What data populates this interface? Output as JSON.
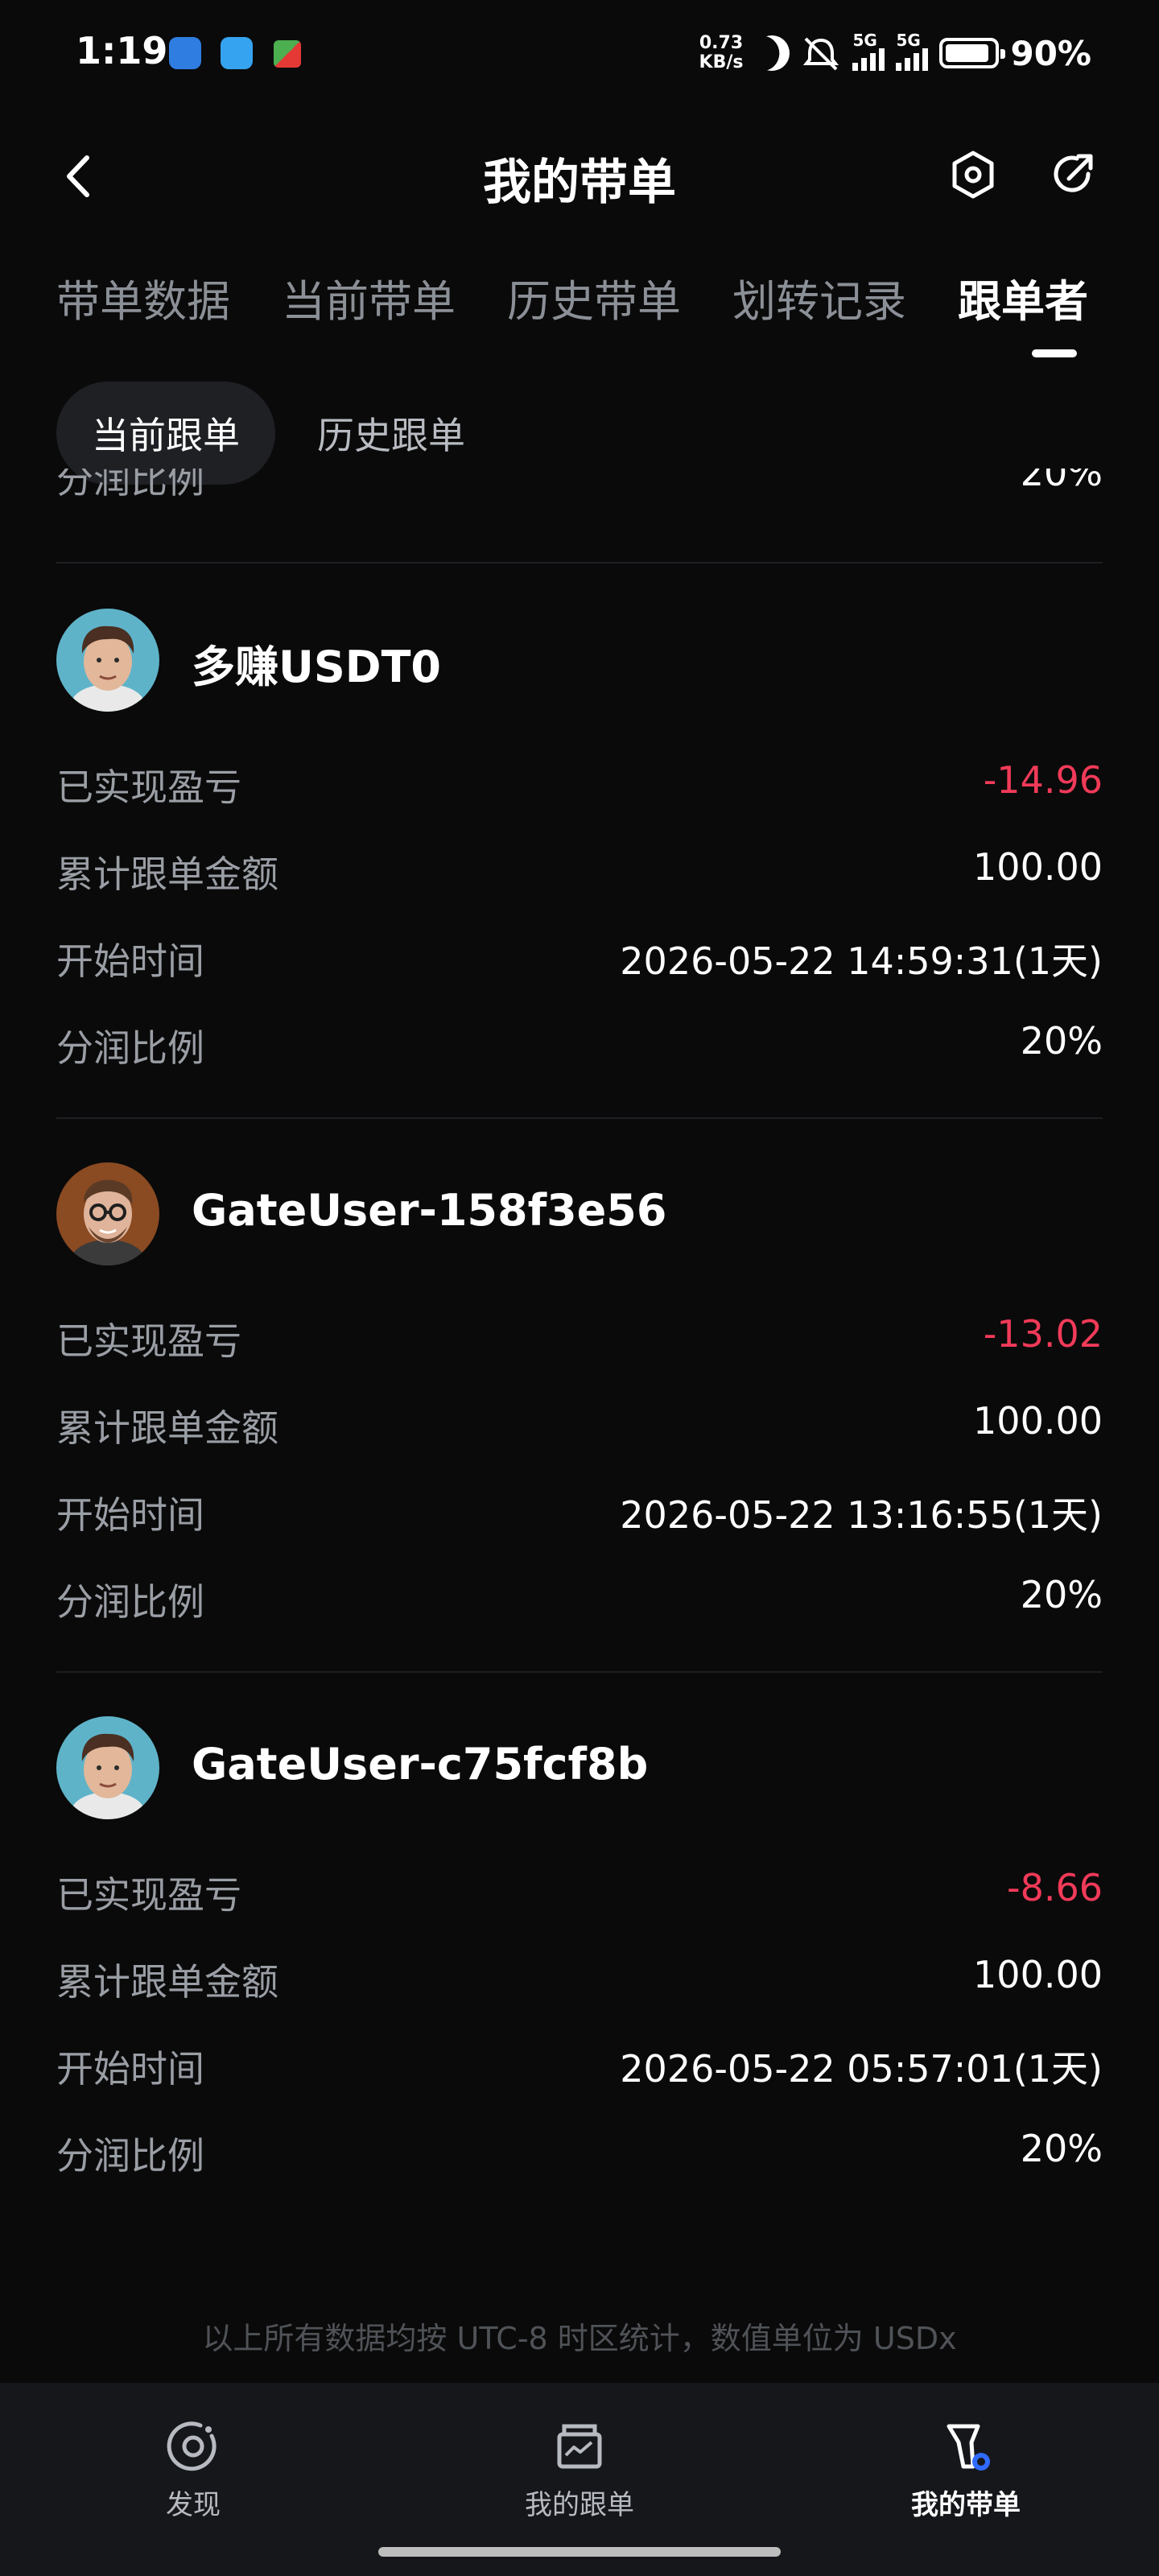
{
  "status_bar": {
    "time": "1:19",
    "net_speed_value": "0.73",
    "net_speed_unit": "KB/s",
    "signal1_label": "5G",
    "signal2_label": "5G",
    "battery": "90%",
    "battery_level": 0.9
  },
  "header": {
    "title": "我的带单",
    "icons": [
      "back-icon",
      "settings-hex-icon",
      "share-icon"
    ]
  },
  "tabs": [
    {
      "label": "带单数据",
      "active": false
    },
    {
      "label": "当前带单",
      "active": false
    },
    {
      "label": "历史带单",
      "active": false
    },
    {
      "label": "划转记录",
      "active": false
    },
    {
      "label": "跟单者",
      "active": true
    }
  ],
  "subtabs": [
    {
      "label": "当前跟单",
      "active": true
    },
    {
      "label": "历史跟单",
      "active": false
    }
  ],
  "partial_row": {
    "label": "分润比例",
    "value": "20%"
  },
  "followers": [
    {
      "name": "多赚USDT0",
      "rows": [
        {
          "label": "已实现盈亏",
          "value": "-14.96"
        },
        {
          "label": "累计跟单金额",
          "value": "100.00"
        },
        {
          "label": "开始时间",
          "value": "2026-05-22 14:59:31(1天)"
        },
        {
          "label": "分润比例",
          "value": "20%"
        }
      ]
    },
    {
      "name": "GateUser-158f3e56",
      "rows": [
        {
          "label": "已实现盈亏",
          "value": "-13.02"
        },
        {
          "label": "累计跟单金额",
          "value": "100.00"
        },
        {
          "label": "开始时间",
          "value": "2026-05-22 13:16:55(1天)"
        },
        {
          "label": "分润比例",
          "value": "20%"
        }
      ]
    },
    {
      "name": "GateUser-c75fcf8b",
      "rows": [
        {
          "label": "已实现盈亏",
          "value": "-8.66"
        },
        {
          "label": "累计跟单金额",
          "value": "100.00"
        },
        {
          "label": "开始时间",
          "value": "2026-05-22 05:57:01(1天)"
        },
        {
          "label": "分润比例",
          "value": "20%"
        }
      ]
    }
  ],
  "footer_note": "以上所有数据均按 UTC-8 时区统计，数值单位为 USDx",
  "bottom_nav": [
    {
      "label": "发现",
      "icon": "discover-icon",
      "active": false
    },
    {
      "label": "我的跟单",
      "icon": "my-copy-icon",
      "active": false
    },
    {
      "label": "我的带单",
      "icon": "my-lead-icon",
      "active": true
    }
  ],
  "colors": {
    "background": "#0a0a0a",
    "negative": "#f23a59",
    "muted_text": "#9a9ea5",
    "nav_background": "#16171b"
  }
}
